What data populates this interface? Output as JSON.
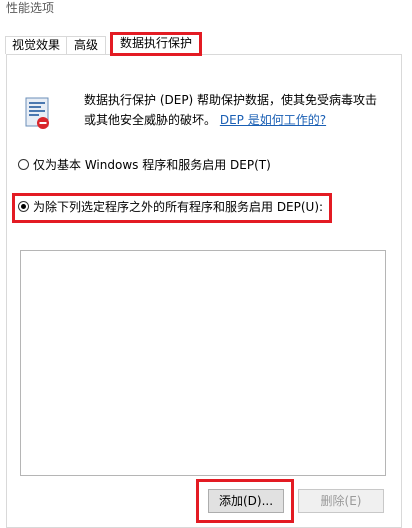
{
  "window": {
    "title": "性能选项"
  },
  "tabs": [
    {
      "label": "视觉效果"
    },
    {
      "label": "高级"
    },
    {
      "label": "数据执行保护"
    }
  ],
  "dep": {
    "description": "数据执行保护 (DEP) 帮助保护数据，使其免受病毒攻击或其他安全威胁的破坏。",
    "link": "DEP 是如何工作的?",
    "icon": "dep-shield-icon",
    "options": [
      {
        "label": "仅为基本 Windows 程序和服务启用 DEP(T)",
        "selected": false
      },
      {
        "label": "为除下列选定程序之外的所有程序和服务启用 DEP(U):",
        "selected": true
      }
    ],
    "program_list": []
  },
  "buttons": {
    "add": "添加(D)...",
    "delete": "删除(E)"
  },
  "colors": {
    "highlight_box": "#e31b23",
    "link": "#1a5fb4"
  }
}
